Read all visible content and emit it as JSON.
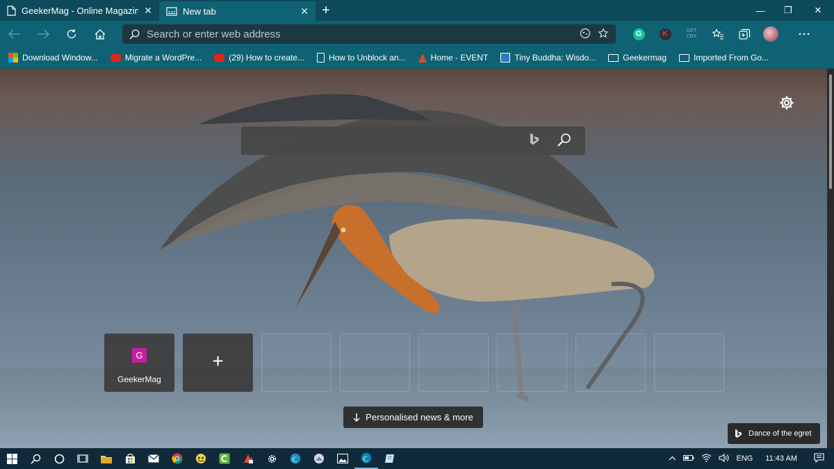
{
  "tabs": [
    {
      "title": "GeekerMag - Online Magazine f",
      "close": "✕",
      "icon": "page-icon"
    },
    {
      "title": "New tab",
      "close": "✕",
      "icon": "newtab-icon"
    }
  ],
  "window": {
    "minimize": "—",
    "maximize": "❐",
    "close": "✕",
    "new_tab": "+"
  },
  "toolbar": {
    "address_placeholder": "Search or enter web address",
    "extensions": {
      "grammarly": "G",
      "k_ext": "K",
      "crx_top": "GET",
      "crx_bottom": "CRX"
    }
  },
  "favorites": [
    {
      "label": "Download Window...",
      "icon": "microsoft-icon"
    },
    {
      "label": "Migrate a WordPre...",
      "icon": "youtube-icon"
    },
    {
      "label": "(29) How to create...",
      "icon": "youtube-icon"
    },
    {
      "label": "How to Unblock an...",
      "icon": "document-icon"
    },
    {
      "label": "Home - EVENT",
      "icon": "event-icon"
    },
    {
      "label": "Tiny Buddha: Wisdo...",
      "icon": "tinybuddha-icon"
    },
    {
      "label": "Geekermag",
      "icon": "folder-icon"
    },
    {
      "label": "Imported From Go...",
      "icon": "folder-icon"
    }
  ],
  "newtab": {
    "quick_links": [
      {
        "label": "GeekerMag",
        "letter": "G",
        "color": "#c61e9e"
      }
    ],
    "add_tile": "+",
    "news_button": "Personalised news & more",
    "image_info": "Dance of the egret"
  },
  "taskbar": {
    "language": "ENG",
    "time": "11:43 AM"
  },
  "colors": {
    "accent": "#0f6273",
    "tabstrip": "#0d4a5a",
    "taskbar": "#102a3a"
  }
}
